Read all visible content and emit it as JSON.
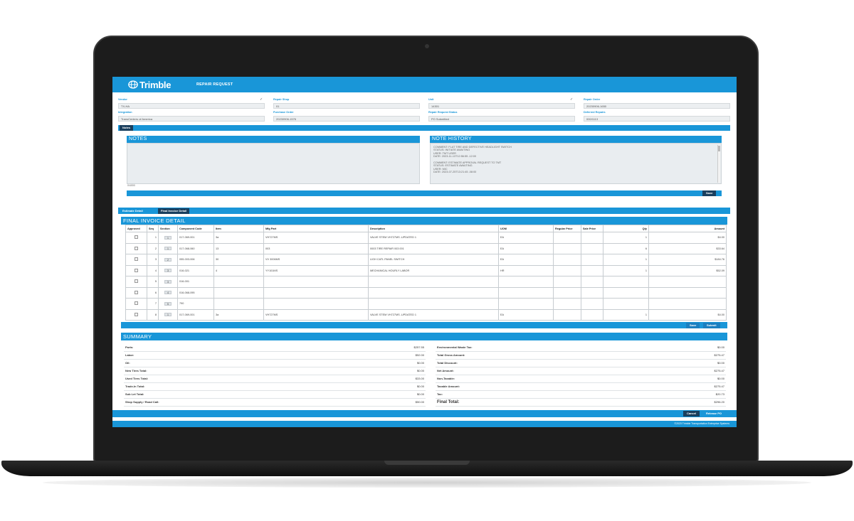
{
  "app": {
    "logo": "Trimble",
    "title": "REPAIR REQUEST",
    "footer": "©2023 Trimble Transportation Enterprise Systems"
  },
  "fields": [
    {
      "label": "Vendor",
      "value": "TX-HA",
      "checked": true
    },
    {
      "label": "Repair Shop",
      "value": "01",
      "checked": false
    },
    {
      "label": "Unit",
      "value": "14301",
      "checked": true
    },
    {
      "label": "Repair Order",
      "value": "20230906-1650",
      "checked": false
    },
    {
      "label": "Integration",
      "value": "TransCenters of America",
      "checked": false
    },
    {
      "label": "Purchase Order",
      "value": "20230906-1576",
      "checked": false
    },
    {
      "label": "Repair Request Status",
      "value": "PO Submitted",
      "checked": false
    },
    {
      "label": "Deferred Repairs",
      "value": "000/1113",
      "checked": false
    }
  ],
  "notes_tab": "Notes",
  "notes": {
    "title": "NOTES",
    "counter": "0/4000",
    "history_title": "NOTE HISTORY",
    "history_lines": [
      "COMMENT: FLAT TIRE AND DEFECTIVE HEADLIGHT SWITCH",
      "STATUS: INITIATE AWAITING",
      "USER: TMT USER",
      "DATE: 2023-11-13T12:56:55 -12:00",
      "",
      "COMMENT: ESTIMATE APPROVAL REQUEST TO TMT",
      "STATUS: ESTIMATE AWAITING",
      "USER: MIC",
      "DATE: 2023-07-25T13:21:45 -08:00"
    ],
    "save_label": "Save"
  },
  "tabs": [
    "Estimate Detail",
    "Final Invoice Detail"
  ],
  "invoice": {
    "title": "FINAL INVOICE DETAIL",
    "columns": [
      "Approved",
      "Seq",
      "Section",
      "Component Code",
      "Item",
      "Mfg Part",
      "Description",
      "UOM",
      "Regular Price",
      "Sale Price",
      "Qty",
      "Amount"
    ],
    "rows": [
      {
        "seq": "1",
        "section": "1",
        "code": "017-069-001",
        "item": "3a",
        "part": "VH727MS",
        "desc": "VALVE STEM VH727MS -UPDATED 1",
        "uom": "EA",
        "qty": "1",
        "amount": "$4.00"
      },
      {
        "seq": "2",
        "section": "1",
        "code": "017-068-060",
        "item": "13",
        "part": "003",
        "desc": "0003 TIRE REPAIR 003 001",
        "uom": "EA",
        "qty": "6",
        "amount": "$33.64"
      },
      {
        "seq": "3",
        "section": "2",
        "code": "055-003-006",
        "item": "30",
        "part": "VV 3006MS",
        "desc": "LIGH CATL PANEL SWITCH",
        "uom": "EA",
        "qty": "1",
        "amount": "$184.76"
      },
      {
        "seq": "4",
        "section": "3",
        "code": "016-021",
        "item": "4",
        "part": "YY101MS",
        "desc": "MECHANICAL HOURLY LABOR",
        "uom": "HR",
        "qty": "1",
        "amount": "$52.09"
      },
      {
        "seq": "5",
        "section": "3",
        "code": "016-001",
        "item": "",
        "part": "",
        "desc": "",
        "uom": "",
        "qty": "",
        "amount": ""
      },
      {
        "seq": "6",
        "section": "4",
        "code": "016-068-095",
        "item": "",
        "part": "",
        "desc": "",
        "uom": "",
        "qty": "",
        "amount": ""
      },
      {
        "seq": "7",
        "section": "5",
        "code": "790",
        "item": "",
        "part": "",
        "desc": "",
        "uom": "",
        "qty": "",
        "amount": ""
      },
      {
        "seq": "8",
        "section": "1",
        "code": "017-069-001",
        "item": "3a",
        "part": "VH727MS",
        "desc": "VALVE STEM VH727MS -UPDATED 1",
        "uom": "EA",
        "qty": "1",
        "amount": "$4.00"
      }
    ],
    "save_label": "Save",
    "submit_label": "Submit"
  },
  "summary": {
    "title": "SUMMARY",
    "left": [
      {
        "label": "Parts:",
        "value": "$257.55"
      },
      {
        "label": "Labor:",
        "value": "$52.00"
      },
      {
        "label": "Oil:",
        "value": "$0.00"
      },
      {
        "label": "New Tires Total:",
        "value": "$0.00"
      },
      {
        "label": "Used Tires Total:",
        "value": "$33.00"
      },
      {
        "label": "Trade-In Total:",
        "value": "$0.00"
      },
      {
        "label": "Sub Let Total:",
        "value": "$0.00"
      },
      {
        "label": "Shop Supply / Road Call:",
        "value": "$50.00"
      }
    ],
    "right": [
      {
        "label": "Environmental Waste Tax:",
        "value": "$0.00"
      },
      {
        "label": "Total Gross Amount:",
        "value": "$275.47"
      },
      {
        "label": "Total Discount:",
        "value": "$0.00"
      },
      {
        "label": "Net Amount:",
        "value": "$275.47"
      },
      {
        "label": "Non-Taxable:",
        "value": "$0.00"
      },
      {
        "label": "Taxable Amount:",
        "value": "$275.47"
      },
      {
        "label": "Tax:",
        "value": "$20.73"
      },
      {
        "label": "Final Total:",
        "value": "$296.20"
      }
    ]
  },
  "actions": {
    "cancel_label": "Cancel",
    "release_label": "Release PO"
  },
  "colors": {
    "accent": "#1996d8",
    "dark": "#1a3f5e",
    "bezel": "#1c1c1c"
  }
}
